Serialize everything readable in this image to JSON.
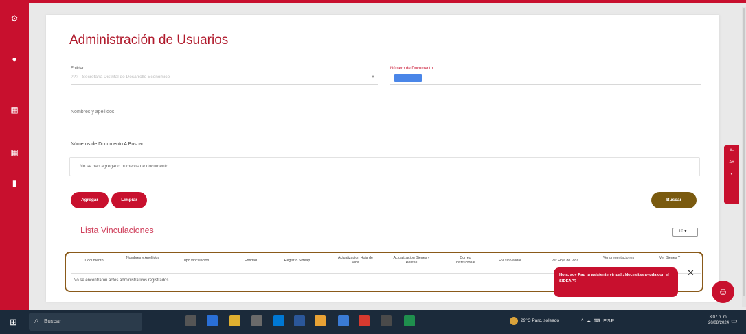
{
  "page": {
    "title": "Administración de Usuarios"
  },
  "form": {
    "entidad": {
      "label": "Entidad",
      "value": "??? - Secretaria Distrital de Desarrollo Económico"
    },
    "numero_documento": {
      "label": "Número de Documento",
      "value": ""
    },
    "nombres": {
      "placeholder": "Nombres y apellidos"
    },
    "buscar_label": "Números de Documento A Buscar",
    "docs_placeholder": "No se han agregado numeros de documento"
  },
  "buttons": {
    "agregar": "Agregar",
    "limpiar": "Limpiar",
    "buscar": "Buscar"
  },
  "section": {
    "title": "Lista Vinculaciones",
    "page_size": "10"
  },
  "table": {
    "headers": [
      "Documento",
      "Nombres y Apellidos",
      "Tipo vinculación",
      "Entidad",
      "Registro Sideap",
      "Actualizacion Hoja de Vida",
      "Actualizacion Bienes y Rentas",
      "Correo Institucional",
      "HV sin validar",
      "Ver Hoja de Vida",
      "Ver presentaciones",
      "Ver Bienes Y"
    ],
    "empty_message": "No se encontraron actos administrativos registrados"
  },
  "chat": {
    "message": "Hola, soy Pau tu asistente virtual ¿Necesitas ayuda con el SIDEAP?"
  },
  "accessibility": [
    "A-",
    "A+",
    "◐"
  ],
  "taskbar": {
    "search_text": "Buscar",
    "weather": "29°C Parc. soleado",
    "tray": "^ ☁ ⌨ ESP",
    "time": "3:07 p. m.",
    "date": "20/08/2024"
  },
  "colors": {
    "brand_red": "#c8102e",
    "buscar_brown": "#7a5a0f"
  }
}
